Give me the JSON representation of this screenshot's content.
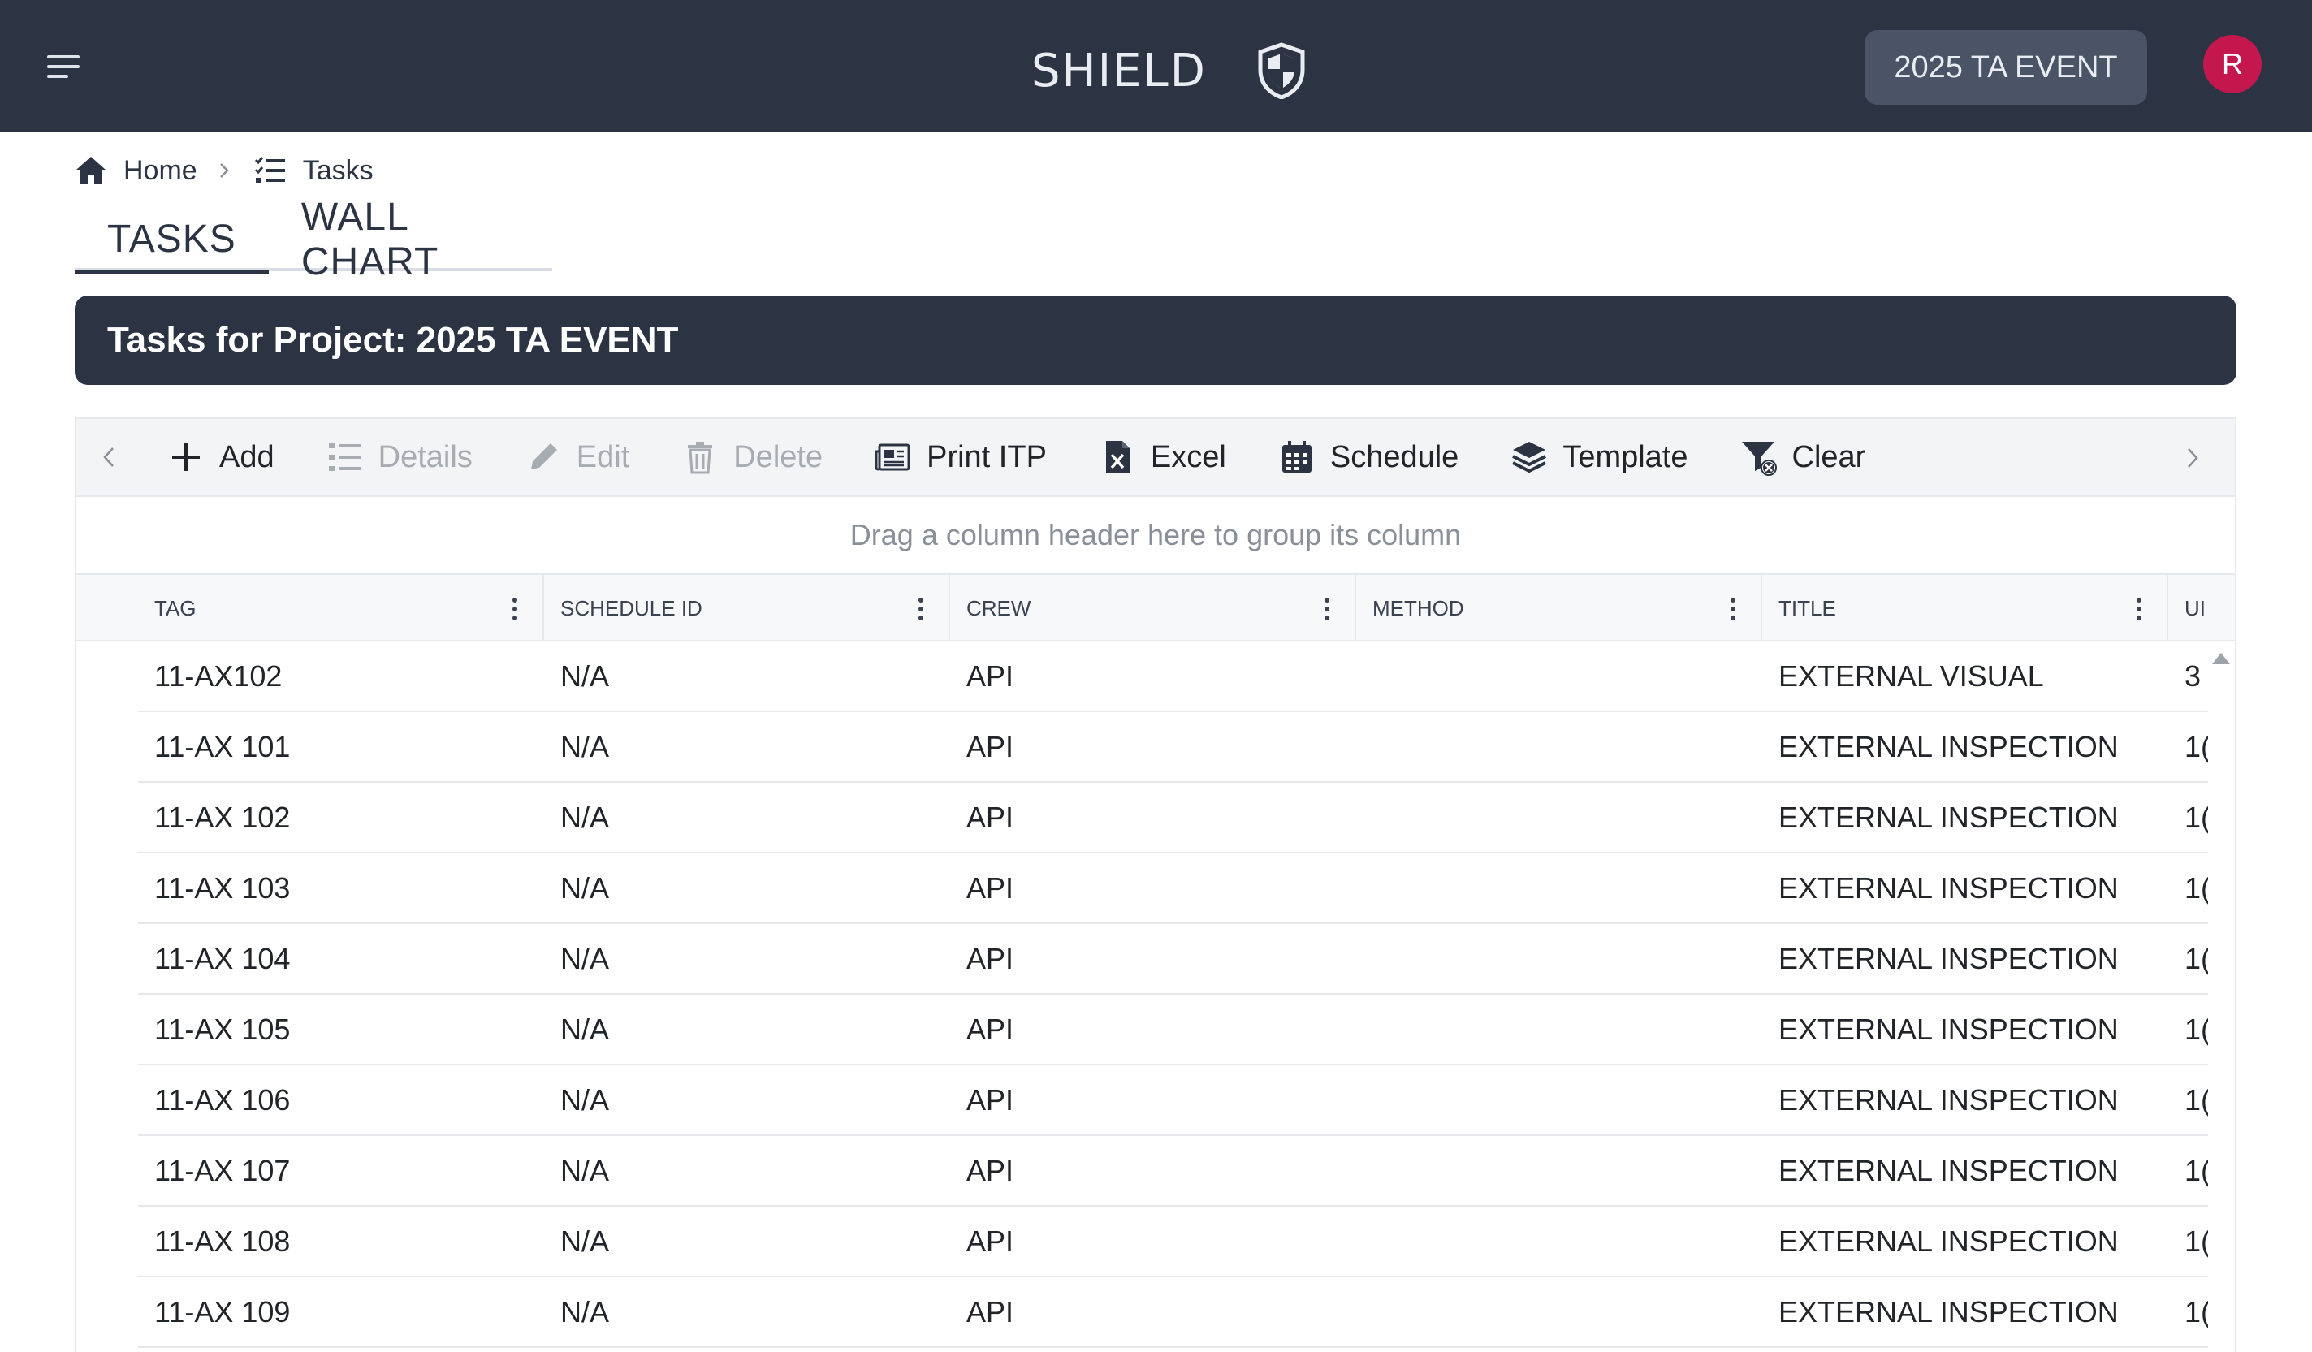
{
  "app": {
    "title": "SHIELD",
    "project_button": "2025 TA EVENT",
    "avatar_initial": "R",
    "icons": [
      "menu-icon",
      "shield-logo-icon"
    ]
  },
  "breadcrumb": {
    "home": "Home",
    "tasks": "Tasks"
  },
  "tabs": [
    {
      "label": "TASKS",
      "active": true
    },
    {
      "label": "WALL CHART",
      "active": false
    }
  ],
  "project_header": "Tasks for Project: 2025 TA EVENT",
  "toolbar": {
    "add": "Add",
    "details": "Details",
    "edit": "Edit",
    "delete": "Delete",
    "print_itp": "Print ITP",
    "excel": "Excel",
    "schedule": "Schedule",
    "template": "Template",
    "clear": "Clear"
  },
  "group_panel_text": "Drag a column header here to group its column",
  "columns": [
    "TAG",
    "SCHEDULE ID",
    "CREW",
    "METHOD",
    "TITLE",
    "UI"
  ],
  "rows": [
    {
      "tag": "11-AX102",
      "schedule_id": "N/A",
      "crew": "API",
      "method": "",
      "title": "EXTERNAL VISUAL",
      "ui": "3"
    },
    {
      "tag": "11-AX 101",
      "schedule_id": "N/A",
      "crew": "API",
      "method": "",
      "title": "EXTERNAL INSPECTION",
      "ui": "1("
    },
    {
      "tag": "11-AX 102",
      "schedule_id": "N/A",
      "crew": "API",
      "method": "",
      "title": "EXTERNAL INSPECTION",
      "ui": "1("
    },
    {
      "tag": "11-AX 103",
      "schedule_id": "N/A",
      "crew": "API",
      "method": "",
      "title": "EXTERNAL INSPECTION",
      "ui": "1("
    },
    {
      "tag": "11-AX 104",
      "schedule_id": "N/A",
      "crew": "API",
      "method": "",
      "title": "EXTERNAL INSPECTION",
      "ui": "1("
    },
    {
      "tag": "11-AX 105",
      "schedule_id": "N/A",
      "crew": "API",
      "method": "",
      "title": "EXTERNAL INSPECTION",
      "ui": "1("
    },
    {
      "tag": "11-AX 106",
      "schedule_id": "N/A",
      "crew": "API",
      "method": "",
      "title": "EXTERNAL INSPECTION",
      "ui": "1("
    },
    {
      "tag": "11-AX 107",
      "schedule_id": "N/A",
      "crew": "API",
      "method": "",
      "title": "EXTERNAL INSPECTION",
      "ui": "1("
    },
    {
      "tag": "11-AX 108",
      "schedule_id": "N/A",
      "crew": "API",
      "method": "",
      "title": "EXTERNAL INSPECTION",
      "ui": "1("
    },
    {
      "tag": "11-AX 109",
      "schedule_id": "N/A",
      "crew": "API",
      "method": "",
      "title": "EXTERNAL INSPECTION",
      "ui": "1("
    }
  ],
  "colors": {
    "navbar": "#2c3443",
    "project_button": "#4a5466",
    "avatar": "#c3174e",
    "toolbar_bg": "#f3f4f6",
    "disabled_text": "#a7abb2"
  }
}
